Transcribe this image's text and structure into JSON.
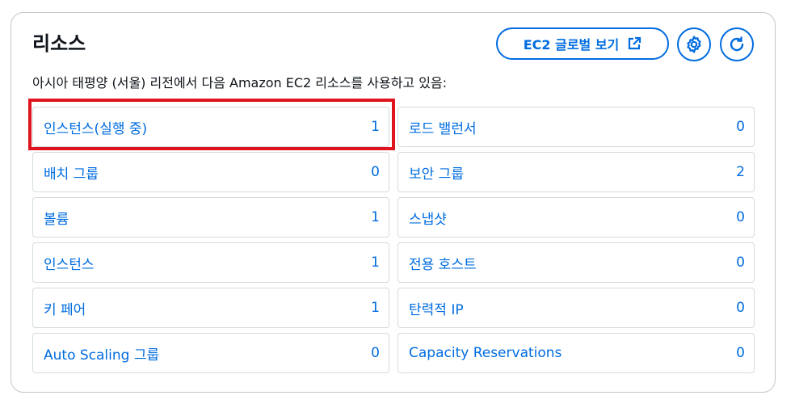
{
  "header": {
    "title": "리소스",
    "description": "아시아 태평양 (서울) 리전에서 다음 Amazon EC2 리소스를 사용하고 있음:",
    "global_view_label": "EC2 글로벌 보기"
  },
  "colors": {
    "link": "#006ce0",
    "highlight": "#e0141e"
  },
  "resources": [
    {
      "label": "인스턴스(실행 중)",
      "value": "1"
    },
    {
      "label": "로드 밸런서",
      "value": "0"
    },
    {
      "label": "배치 그룹",
      "value": "0"
    },
    {
      "label": "보안 그룹",
      "value": "2"
    },
    {
      "label": "볼륨",
      "value": "1"
    },
    {
      "label": "스냅샷",
      "value": "0"
    },
    {
      "label": "인스턴스",
      "value": "1"
    },
    {
      "label": "전용 호스트",
      "value": "0"
    },
    {
      "label": "키 페어",
      "value": "1"
    },
    {
      "label": "탄력적 IP",
      "value": "0"
    },
    {
      "label": "Auto Scaling 그룹",
      "value": "0"
    },
    {
      "label": "Capacity Reservations",
      "value": "0"
    }
  ]
}
